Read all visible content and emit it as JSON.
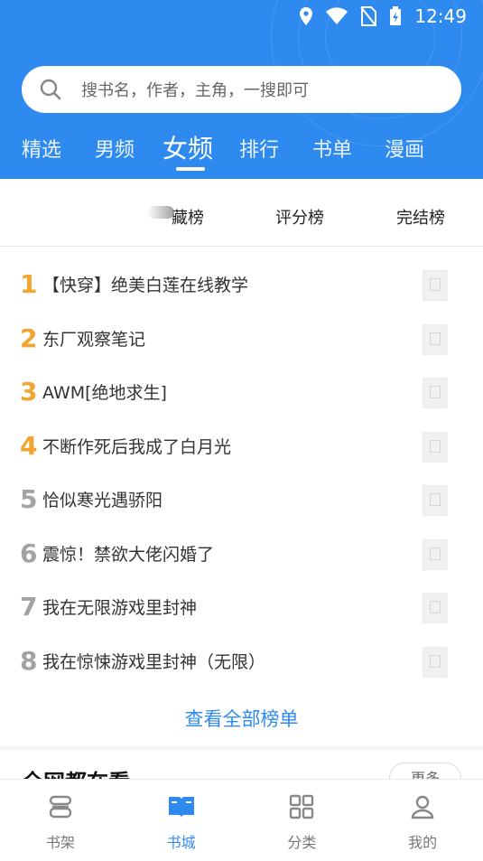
{
  "status_bar": {
    "time": "12:49"
  },
  "search": {
    "placeholder": "搜书名，作者，主角，一搜即可"
  },
  "top_tabs": [
    {
      "label": "精选",
      "active": false
    },
    {
      "label": "男频",
      "active": false
    },
    {
      "label": "女频",
      "active": true
    },
    {
      "label": "排行",
      "active": false
    },
    {
      "label": "书单",
      "active": false
    },
    {
      "label": "漫画",
      "active": false
    }
  ],
  "sub_tabs": [
    {
      "label": "藏榜"
    },
    {
      "label": "评分榜"
    },
    {
      "label": "完结榜"
    }
  ],
  "ranking": [
    {
      "rank": "1",
      "title": "【快穿】绝美白莲在线教学"
    },
    {
      "rank": "2",
      "title": "东厂观察笔记"
    },
    {
      "rank": "3",
      "title": "AWM[绝地求生]"
    },
    {
      "rank": "4",
      "title": "不断作死后我成了白月光"
    },
    {
      "rank": "5",
      "title": "恰似寒光遇骄阳"
    },
    {
      "rank": "6",
      "title": "震惊！禁欲大佬闪婚了"
    },
    {
      "rank": "7",
      "title": "我在无限游戏里封神"
    },
    {
      "rank": "8",
      "title": "我在惊悚游戏里封神（无限）"
    }
  ],
  "view_all": "查看全部榜单",
  "section": {
    "title": "全网都在看",
    "more": "更多"
  },
  "bottom_nav": [
    {
      "label": "书架",
      "icon": "bookshelf-icon",
      "active": false
    },
    {
      "label": "书城",
      "icon": "book-open-icon",
      "active": true
    },
    {
      "label": "分类",
      "icon": "grid-icon",
      "active": false
    },
    {
      "label": "我的",
      "icon": "user-icon",
      "active": false
    }
  ],
  "colors": {
    "primary": "#2f8af0",
    "rank_top": "#f2a531",
    "rank_other": "#a3a3a3"
  }
}
